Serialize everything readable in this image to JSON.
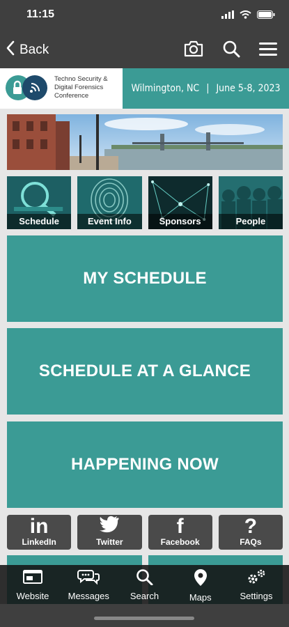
{
  "status": {
    "time": "11:15"
  },
  "nav": {
    "back_label": "Back"
  },
  "banner": {
    "org_line1": "Techno Security &",
    "org_line2": "Digital Forensics",
    "org_line3": "Conference",
    "location": "Wilmington, NC",
    "separator": "|",
    "dates": "June 5-8, 2023"
  },
  "tiles": [
    {
      "label": "Schedule"
    },
    {
      "label": "Event Info"
    },
    {
      "label": "Sponsors"
    },
    {
      "label": "People"
    }
  ],
  "big_buttons": [
    {
      "label": "MY SCHEDULE"
    },
    {
      "label": "SCHEDULE AT A GLANCE"
    },
    {
      "label": "HAPPENING NOW"
    }
  ],
  "social": [
    {
      "label": "LinkedIn",
      "glyph": "in"
    },
    {
      "label": "Twitter",
      "glyph": "🐦"
    },
    {
      "label": "Facebook",
      "glyph": "f"
    },
    {
      "label": "FAQs",
      "glyph": "?"
    }
  ],
  "tabbar": [
    {
      "label": "Website",
      "icon": "website-icon"
    },
    {
      "label": "Messages",
      "icon": "messages-icon"
    },
    {
      "label": "Search",
      "icon": "search-icon"
    },
    {
      "label": "Maps",
      "icon": "map-pin-icon"
    },
    {
      "label": "Settings",
      "icon": "gears-icon"
    }
  ],
  "colors": {
    "teal": "#3b9b95",
    "dark": "#3f3f3f",
    "navy": "#1e4a6b"
  }
}
